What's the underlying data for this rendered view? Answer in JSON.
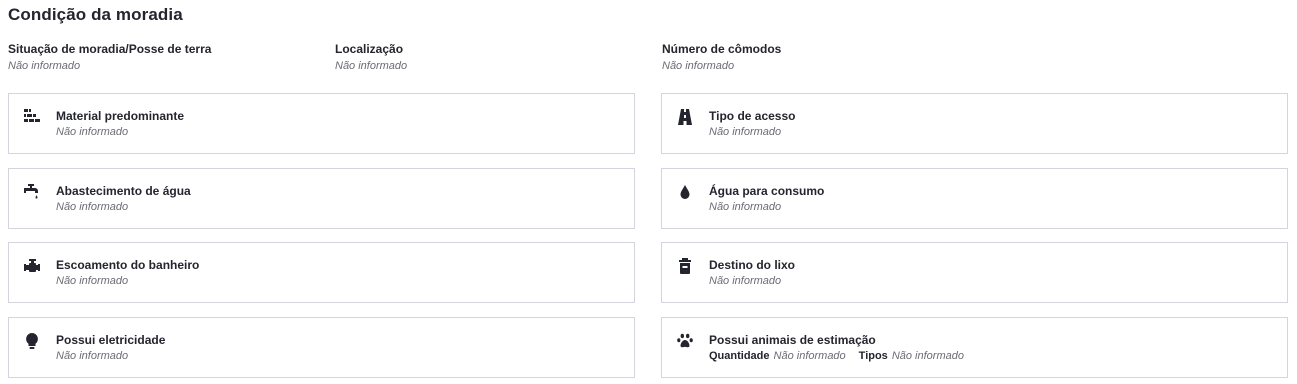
{
  "section": {
    "title": "Condição da moradia"
  },
  "info_fields": [
    {
      "label": "Situação de moradia/Posse de terra",
      "value": "Não informado"
    },
    {
      "label": "Localização",
      "value": "Não informado"
    },
    {
      "label": "Número de cômodos",
      "value": "Não informado"
    }
  ],
  "cards": {
    "material": {
      "icon": "bricks-icon",
      "title": "Material predominante",
      "value": "Não informado"
    },
    "acesso": {
      "icon": "road-icon",
      "title": "Tipo de acesso",
      "value": "Não informado"
    },
    "abastecimento": {
      "icon": "faucet-icon",
      "title": "Abastecimento de água",
      "value": "Não informado"
    },
    "agua_consumo": {
      "icon": "water-drop-icon",
      "title": "Água para consumo",
      "value": "Não informado"
    },
    "escoamento": {
      "icon": "pipe-valve-icon",
      "title": "Escoamento do banheiro",
      "value": "Não informado"
    },
    "lixo": {
      "icon": "trash-can-icon",
      "title": "Destino do lixo",
      "value": "Não informado"
    },
    "eletricidade": {
      "icon": "lightbulb-icon",
      "title": "Possui eletricidade",
      "value": "Não informado"
    },
    "animais": {
      "icon": "paw-icon",
      "title": "Possui animais de estimação",
      "quantidade_label": "Quantidade",
      "quantidade_value": "Não informado",
      "tipos_label": "Tipos",
      "tipos_value": "Não informado"
    }
  }
}
